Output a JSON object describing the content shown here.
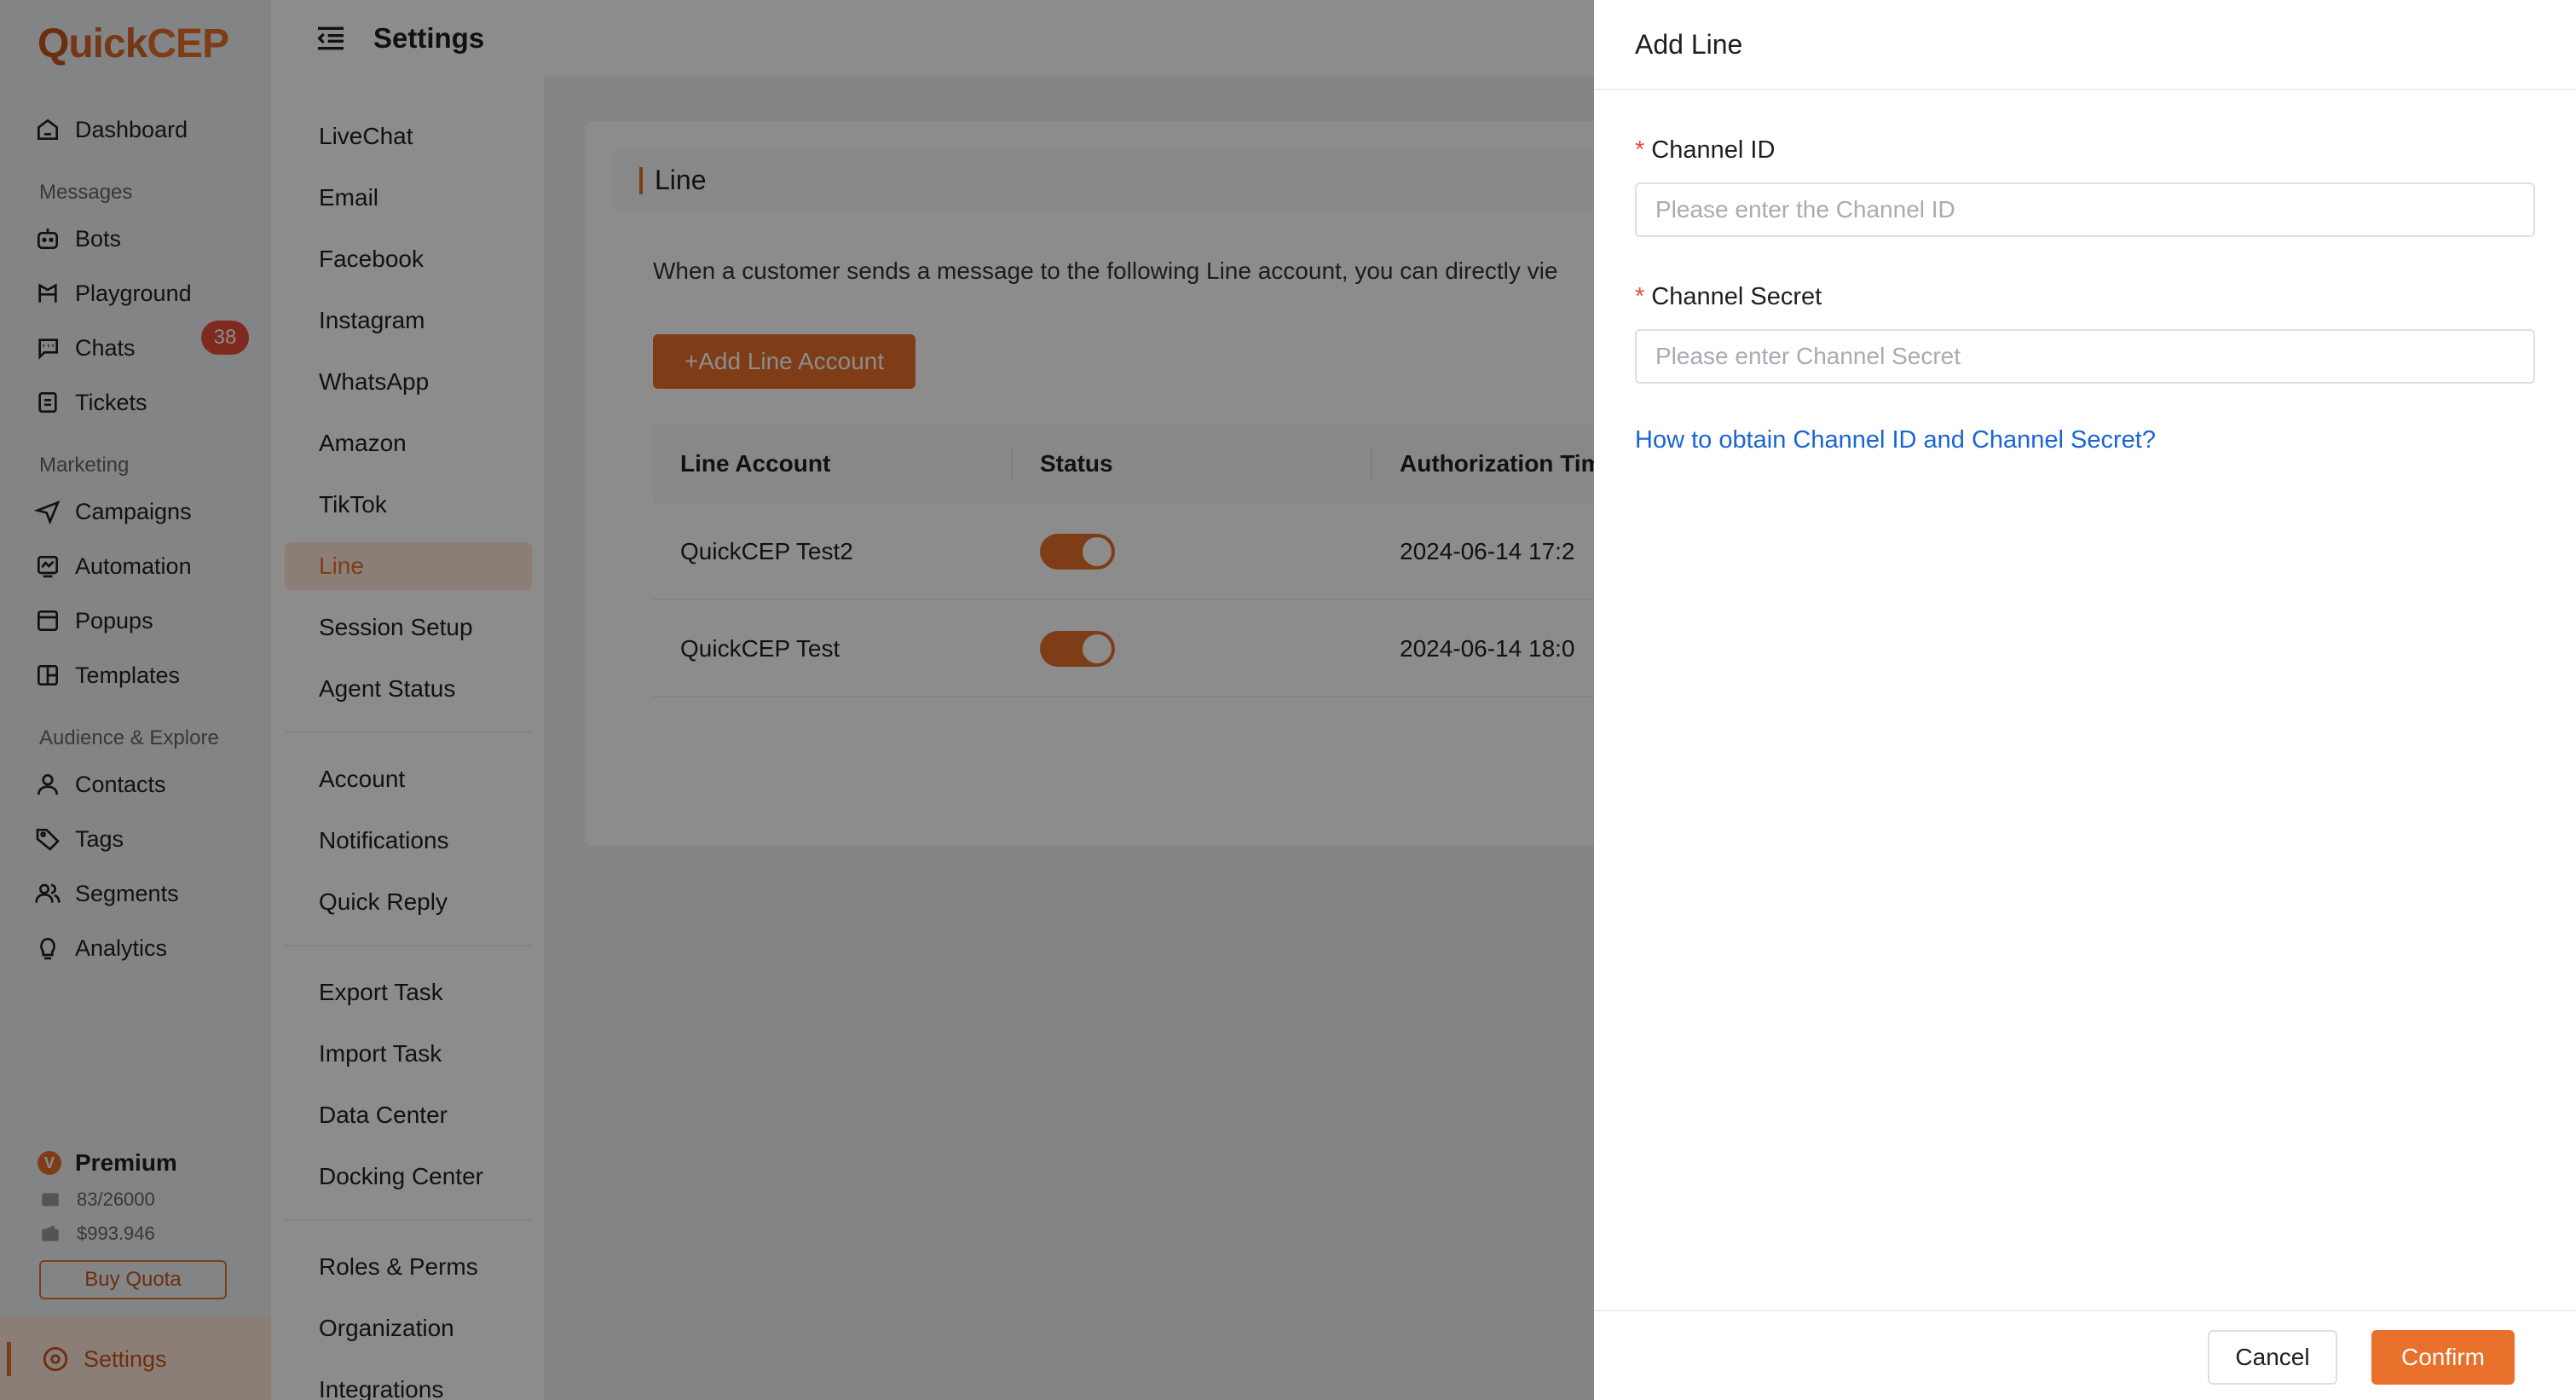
{
  "app": {
    "logo_q": "Q",
    "logo_uick": "uick",
    "logo_cep": "CEP"
  },
  "nav": {
    "dashboard": "Dashboard",
    "group_messages": "Messages",
    "bots": "Bots",
    "playground": "Playground",
    "chats": "Chats",
    "chats_badge": "38",
    "tickets": "Tickets",
    "group_marketing": "Marketing",
    "campaigns": "Campaigns",
    "automation": "Automation",
    "popups": "Popups",
    "templates": "Templates",
    "group_audience": "Audience & Explore",
    "contacts": "Contacts",
    "tags": "Tags",
    "segments": "Segments",
    "analytics": "Analytics",
    "plan_badge": "V",
    "plan": "Premium",
    "mail_quota": "83/26000",
    "balance": "$993.946",
    "buy_quota": "Buy Quota",
    "settings": "Settings"
  },
  "header": {
    "title": "Settings"
  },
  "subnav": {
    "items": [
      "LiveChat",
      "Email",
      "Facebook",
      "Instagram",
      "WhatsApp",
      "Amazon",
      "TikTok",
      "Line",
      "Session Setup",
      "Agent Status"
    ],
    "items2": [
      "Account",
      "Notifications",
      "Quick Reply"
    ],
    "items3": [
      "Export Task",
      "Import Task",
      "Data Center",
      "Docking Center"
    ],
    "items4": [
      "Roles & Perms",
      "Organization",
      "Integrations"
    ],
    "active": "Line"
  },
  "content": {
    "title": "Line",
    "description": "When a customer sends a message to the following Line account, you can directly vie",
    "add_button": "+Add Line Account",
    "columns": [
      "Line Account",
      "Status",
      "Authorization Tim"
    ],
    "rows": [
      {
        "account": "QuickCEP Test2",
        "status_on": true,
        "auth_time": "2024-06-14 17:2"
      },
      {
        "account": "QuickCEP Test",
        "status_on": true,
        "auth_time": "2024-06-14 18:0"
      }
    ]
  },
  "drawer": {
    "title": "Add Line",
    "required_mark": "*",
    "channel_id_label": "Channel ID",
    "channel_id_placeholder": "Please enter the Channel ID",
    "channel_secret_label": "Channel Secret",
    "channel_secret_placeholder": "Please enter Channel Secret",
    "help_link": "How to obtain Channel ID and Channel Secret?",
    "cancel": "Cancel",
    "confirm": "Confirm"
  },
  "colors": {
    "accent": "#e8702a",
    "badge": "#e54d3a",
    "link": "#1a64d6"
  }
}
